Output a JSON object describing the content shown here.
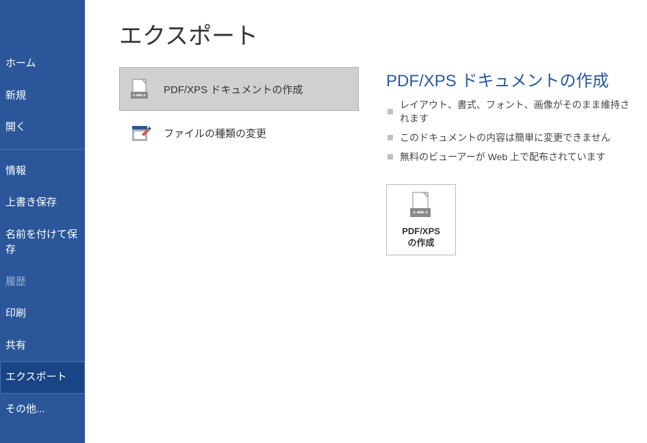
{
  "sidebar": {
    "items": [
      {
        "label": "ホーム"
      },
      {
        "label": "新規"
      },
      {
        "label": "開く"
      },
      {
        "label": "情報"
      },
      {
        "label": "上書き保存"
      },
      {
        "label": "名前を付けて保存"
      },
      {
        "label": "履歴"
      },
      {
        "label": "印刷"
      },
      {
        "label": "共有"
      },
      {
        "label": "エクスポート"
      },
      {
        "label": "その他..."
      }
    ]
  },
  "page": {
    "title": "エクスポート"
  },
  "options": {
    "pdfxps": "PDF/XPS ドキュメントの作成",
    "changetype": "ファイルの種類の変更"
  },
  "detail": {
    "title": "PDF/XPS ドキュメントの作成",
    "bullets": [
      "レイアウト、書式、フォント、画像がそのまま維持されます",
      "このドキュメントの内容は簡単に変更できません",
      "無料のビューアーが Web 上で配布されています"
    ],
    "button_line1": "PDF/XPS",
    "button_line2": "の作成"
  }
}
